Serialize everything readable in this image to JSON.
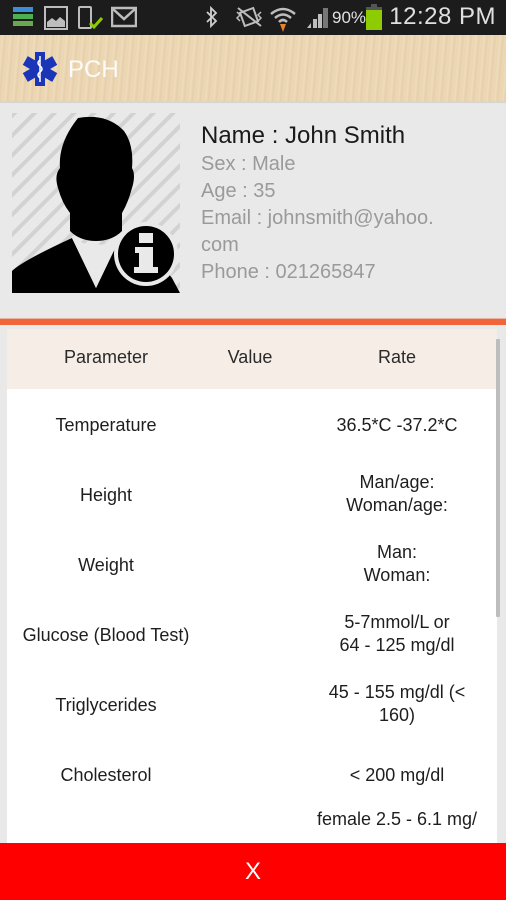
{
  "status_bar": {
    "time": "12:28 PM",
    "battery_percent": "90%",
    "icons": [
      "storage-icon",
      "gallery-icon",
      "phone-check-icon",
      "gmail-icon",
      "bluetooth-icon",
      "vibrate-mute-icon",
      "wifi-icon",
      "signal-icon",
      "battery-icon"
    ],
    "battery_color": "#8ccc00"
  },
  "action_bar": {
    "title": "PCH",
    "logo_icon": "star-of-life-icon",
    "logo_color": "#1a35b8"
  },
  "profile": {
    "avatar_icon": "user-info-icon",
    "name": "Name : John Smith",
    "sex": "Sex : Male",
    "age": "Age : 35",
    "email_line1": "Email : johnsmith@yahoo.",
    "email_line2": "com",
    "phone": "Phone : 021265847"
  },
  "accent_color": "#f0663a",
  "table": {
    "headers": {
      "parameter": "Parameter",
      "value": "Value",
      "rate": "Rate"
    },
    "rows": [
      {
        "parameter": "Temperature",
        "value": "",
        "rate": "36.5*C -37.2*C"
      },
      {
        "parameter": "Height",
        "value": "",
        "rate": "Man/age:\nWoman/age:"
      },
      {
        "parameter": "Weight",
        "value": "",
        "rate": "Man:\nWoman:"
      },
      {
        "parameter": "Glucose (Blood Test)",
        "value": "",
        "rate": "5-7mmol/L or\n64 - 125 mg/dl"
      },
      {
        "parameter": "Triglycerides",
        "value": "",
        "rate": "45 - 155 mg/dl  (<\n160)"
      },
      {
        "parameter": "Cholesterol",
        "value": "",
        "rate": "< 200 mg/dl"
      },
      {
        "parameter": "",
        "value": "",
        "rate": "female  2.5 - 6.1 mg/"
      }
    ]
  },
  "close_button": {
    "label": "X",
    "color": "#ff0000"
  }
}
